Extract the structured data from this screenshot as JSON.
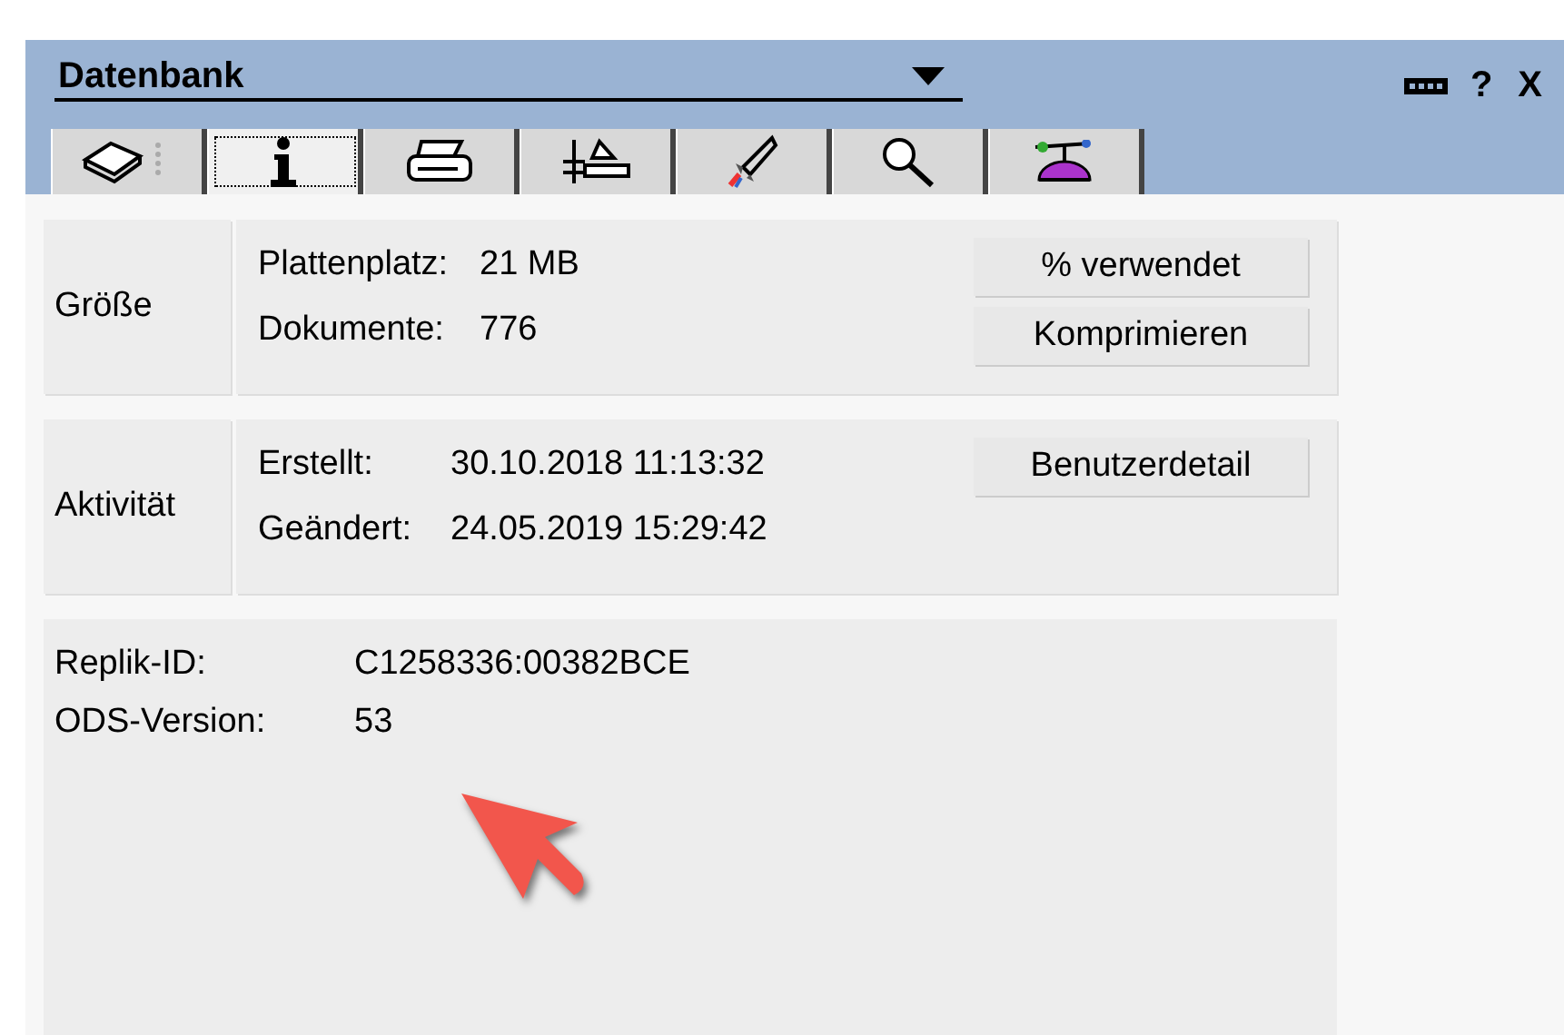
{
  "panel": {
    "title": "Datenbank",
    "controls": [
      "?",
      "X"
    ]
  },
  "tabs": [
    {
      "selected": false
    },
    {
      "selected": true
    },
    {
      "selected": false
    },
    {
      "selected": false
    },
    {
      "selected": false
    },
    {
      "selected": false
    },
    {
      "selected": false
    }
  ],
  "sections": [
    {
      "label": "Größe",
      "rows": [
        {
          "name": "Plattenplatz:",
          "value": "21 MB"
        },
        {
          "name": "Dokumente:",
          "value": "776"
        }
      ],
      "buttons": [
        "% verwendet",
        "Komprimieren"
      ]
    },
    {
      "label": "Aktivität",
      "rows": [
        {
          "name": "Erstellt:",
          "value": "30.10.2018 11:13:32"
        },
        {
          "name": "Geändert:",
          "value": "24.05.2019 15:29:42"
        }
      ],
      "buttons": [
        "Benutzerdetail"
      ]
    }
  ],
  "info": [
    {
      "name": "Replik-ID:",
      "value": "C1258336:00382BCE"
    },
    {
      "name": "ODS-Version:",
      "value": "53"
    }
  ]
}
